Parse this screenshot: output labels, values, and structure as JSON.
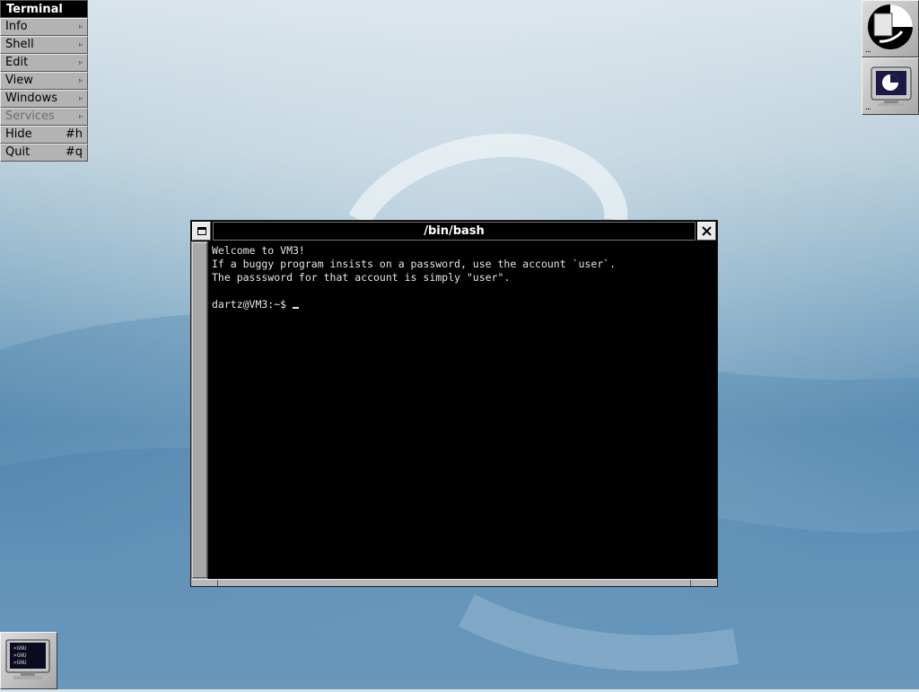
{
  "menu": {
    "title": "Terminal",
    "items": [
      {
        "label": "Info",
        "submenu": true,
        "enabled": true
      },
      {
        "label": "Shell",
        "submenu": true,
        "enabled": true
      },
      {
        "label": "Edit",
        "submenu": true,
        "enabled": true
      },
      {
        "label": "View",
        "submenu": true,
        "enabled": true
      },
      {
        "label": "Windows",
        "submenu": true,
        "enabled": true
      },
      {
        "label": "Services",
        "submenu": true,
        "enabled": false
      },
      {
        "label": "Hide",
        "shortcut": "#h",
        "enabled": true
      },
      {
        "label": "Quit",
        "shortcut": "#q",
        "enabled": true
      }
    ],
    "arrow_glyph": "▹"
  },
  "dock": {
    "items": [
      {
        "name": "workspace-manager-icon",
        "dots": "..."
      },
      {
        "name": "terminal-app-icon",
        "dots": "..."
      }
    ]
  },
  "appicon": {
    "name": "gnu-terminal-icon",
    "lines": [
      ">GNU",
      ">GNU",
      ">GNU"
    ]
  },
  "window": {
    "title": "/bin/bash",
    "lines": [
      "Welcome to VM3!",
      "If a buggy program insists on a password, use the account `user`.",
      "The passsword for that account is simply \"user\".",
      "",
      "dartz@VM3:~$ "
    ]
  },
  "colors": {
    "terminal_bg": "#000000",
    "terminal_fg": "#e6e6e6",
    "menu_bg": "#b3b3b3",
    "title_bg": "#000000"
  }
}
